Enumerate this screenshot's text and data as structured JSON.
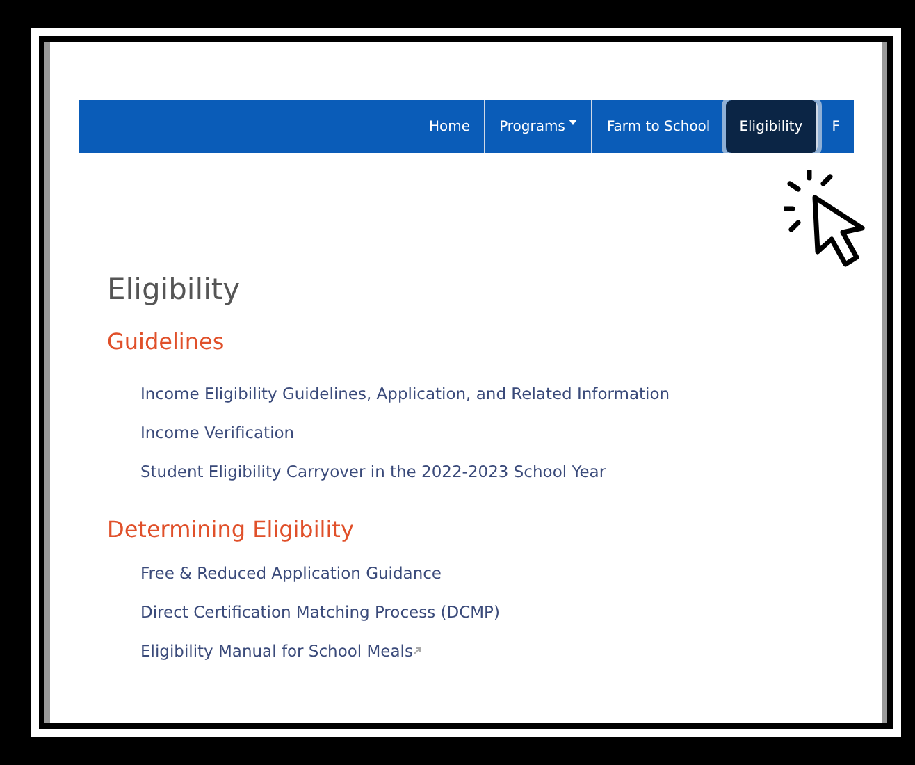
{
  "nav": {
    "items": [
      {
        "label": "Home",
        "selected": false,
        "dropdown": false
      },
      {
        "label": "Programs",
        "selected": false,
        "dropdown": true
      },
      {
        "label": "Farm to School",
        "selected": false,
        "dropdown": false
      },
      {
        "label": "Eligibility",
        "selected": true,
        "dropdown": false
      },
      {
        "label": "F",
        "selected": false,
        "dropdown": false
      }
    ]
  },
  "page_title": "Eligibility",
  "sections": [
    {
      "heading": "Guidelines",
      "links": [
        {
          "label": "Income Eligibility Guidelines, Application, and Related Information",
          "external": false
        },
        {
          "label": "Income Verification",
          "external": false
        },
        {
          "label": "Student Eligibility Carryover in the 2022-2023 School Year",
          "external": false
        }
      ]
    },
    {
      "heading": "Determining Eligibility",
      "links": [
        {
          "label": "Free & Reduced Application Guidance",
          "external": false
        },
        {
          "label": "Direct Certification Matching Process (DCMP)",
          "external": false
        },
        {
          "label": "Eligibility Manual for School Meals",
          "external": true
        }
      ]
    }
  ]
}
